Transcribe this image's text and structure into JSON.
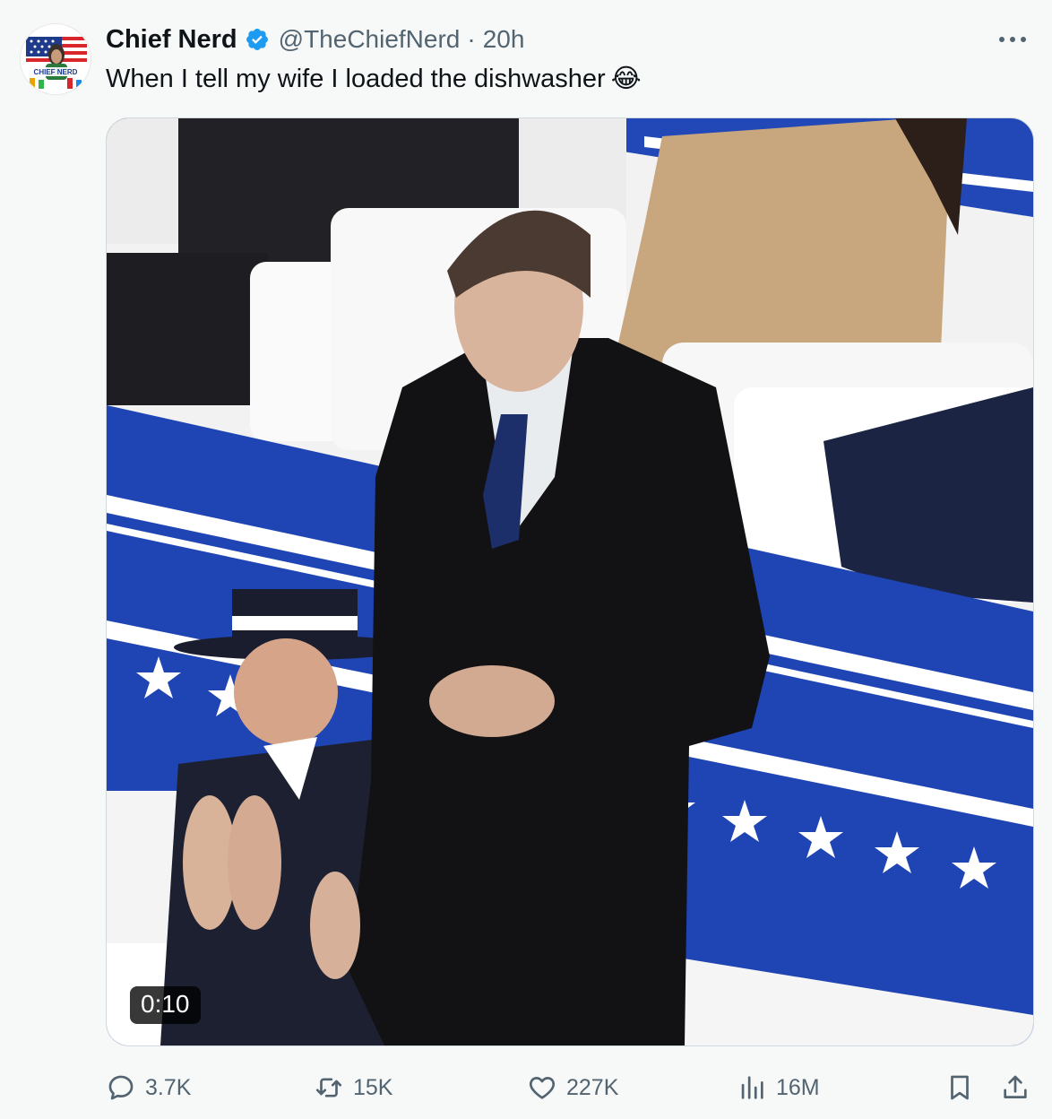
{
  "tweet": {
    "display_name": "Chief Nerd",
    "handle": "@TheChiefNerd",
    "separator": "·",
    "time": "20h",
    "text": "When I tell my wife I loaded the dishwasher",
    "emoji": "😂",
    "avatar_label": "CHIEF NERD",
    "more_label": "•••"
  },
  "media": {
    "duration": "0:10"
  },
  "actions": {
    "replies": "3.7K",
    "reposts": "15K",
    "likes": "227K",
    "views": "16M"
  },
  "colors": {
    "text": "#0f1419",
    "secondary": "#536471",
    "verified": "#1d9bf0",
    "background": "#f7f9f9"
  },
  "icons": {
    "reply": "reply-icon",
    "retweet": "retweet-icon",
    "like": "heart-icon",
    "views": "views-icon",
    "bookmark": "bookmark-icon",
    "share": "share-icon",
    "verified": "verified-badge-icon",
    "more": "more-icon"
  }
}
